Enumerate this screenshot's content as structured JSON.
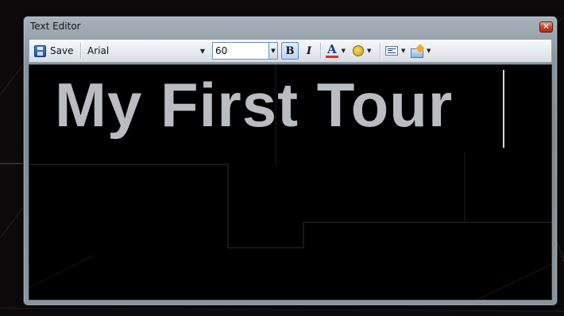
{
  "window": {
    "title": "Text Editor",
    "close_glyph": "×"
  },
  "toolbar": {
    "save_label": "Save",
    "save_icon": "floppy-disk-icon",
    "font_family": "Arial",
    "font_size": "60",
    "bold_glyph": "B",
    "italic_glyph": "I",
    "font_color_glyph": "A",
    "font_color": "#e0301a",
    "dropdown_glyph": "▼"
  },
  "editor": {
    "text": "My First Tour",
    "text_color": "#b9bcc1",
    "background": "#000000"
  }
}
